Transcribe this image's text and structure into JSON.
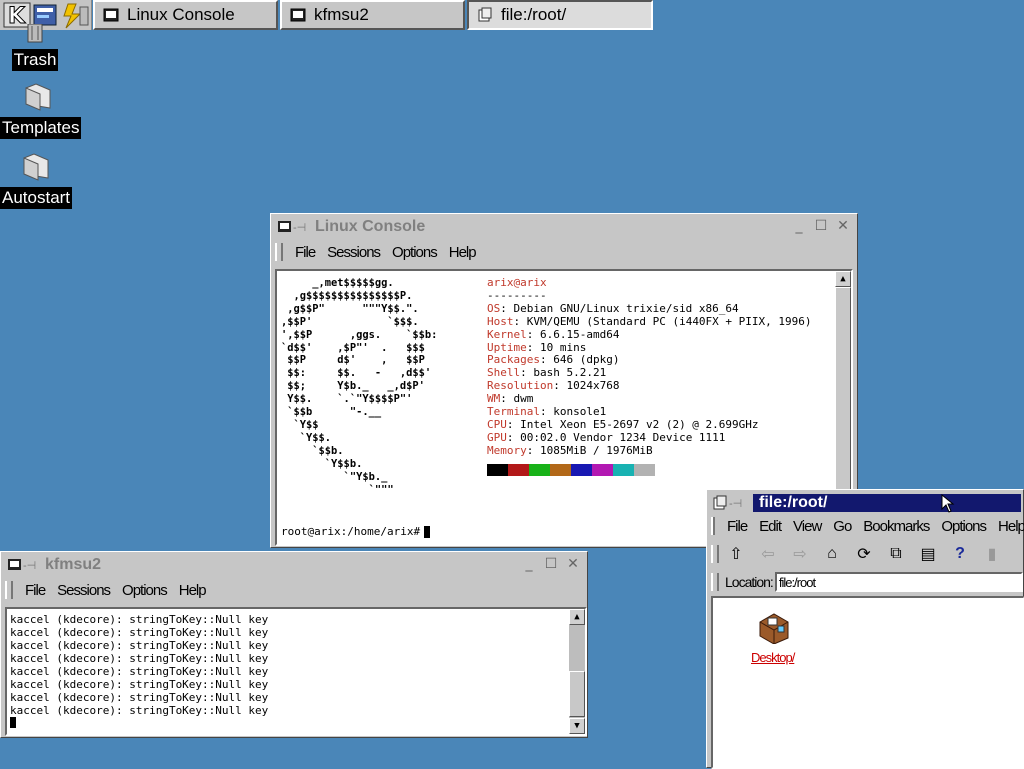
{
  "taskbar": {
    "tasks": [
      {
        "label": "Linux Console",
        "active": false
      },
      {
        "label": "kfmsu2",
        "active": false
      },
      {
        "label": "file:/root/",
        "active": true
      }
    ]
  },
  "desktop": {
    "icons": [
      {
        "label": "Trash",
        "icon": "trash-icon"
      },
      {
        "label": "Templates",
        "icon": "folder-icon"
      },
      {
        "label": "Autostart",
        "icon": "folder-icon"
      }
    ]
  },
  "console_window": {
    "title": "Linux Console",
    "menu": [
      "File",
      "Sessions",
      "Options",
      "Help"
    ],
    "ascii_logo": "     _,met$$$$$gg.\n  ,g$$$$$$$$$$$$$$$P.\n ,g$$P\"      \"\"\"Y$$.\".\n,$$P'            `$$$.\n',$$P      ,ggs.    `$$b:\n`d$$'    ,$P\"'  .   $$$\n $$P     d$'    ,   $$P\n $$:     $$.   -   ,d$$'\n $$;     Y$b._   _,d$P'\n Y$$.    `.`\"Y$$$$P\"'\n `$$b      \"-.__\n  `Y$$\n   `Y$$.\n     `$$b.\n       `Y$$b.\n          `\"Y$b._\n              `\"\"\"",
    "user_host": "arix@arix",
    "separator": "---------",
    "info": [
      {
        "label": "OS",
        "value": "Debian GNU/Linux trixie/sid x86_64"
      },
      {
        "label": "Host",
        "value": "KVM/QEMU (Standard PC (i440FX + PIIX, 1996)"
      },
      {
        "label": "Kernel",
        "value": "6.6.15-amd64"
      },
      {
        "label": "Uptime",
        "value": "10 mins"
      },
      {
        "label": "Packages",
        "value": "646 (dpkg)"
      },
      {
        "label": "Shell",
        "value": "bash 5.2.21"
      },
      {
        "label": "Resolution",
        "value": "1024x768"
      },
      {
        "label": "WM",
        "value": "dwm"
      },
      {
        "label": "Terminal",
        "value": "konsole1"
      },
      {
        "label": "CPU",
        "value": "Intel Xeon E5-2697 v2 (2) @ 2.699GHz"
      },
      {
        "label": "GPU",
        "value": "00:02.0 Vendor 1234 Device 1111"
      },
      {
        "label": "Memory",
        "value": "1085MiB / 1976MiB"
      }
    ],
    "swatch_colors": [
      "#000000",
      "#b21818",
      "#18b218",
      "#b26818",
      "#1818b2",
      "#b218b2",
      "#18b2b2",
      "#b2b2b2"
    ],
    "prompt": "root@arix:/home/arix#"
  },
  "kfmsu_window": {
    "title": "kfmsu2",
    "menu": [
      "File",
      "Sessions",
      "Options",
      "Help"
    ],
    "lines": [
      "kaccel (kdecore): stringToKey::Null key",
      "kaccel (kdecore): stringToKey::Null key",
      "kaccel (kdecore): stringToKey::Null key",
      "kaccel (kdecore): stringToKey::Null key",
      "kaccel (kdecore): stringToKey::Null key",
      "kaccel (kdecore): stringToKey::Null key",
      "kaccel (kdecore): stringToKey::Null key",
      "kaccel (kdecore): stringToKey::Null key"
    ]
  },
  "konqueror_window": {
    "title": "file:/root/",
    "menu": [
      "File",
      "Edit",
      "View",
      "Go",
      "Bookmarks",
      "Options",
      "Help"
    ],
    "location_label": "Location:",
    "location_value": "file:/root",
    "items": [
      {
        "label": "Desktop/",
        "icon": "desktop-folder-icon"
      }
    ]
  }
}
